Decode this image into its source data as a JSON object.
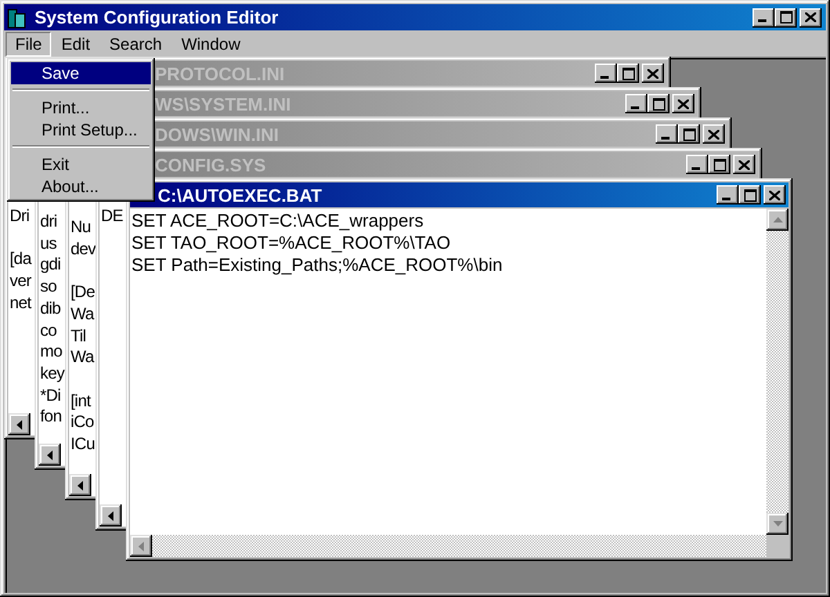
{
  "window": {
    "title": "System Configuration Editor"
  },
  "menu_bar": [
    {
      "label": "File",
      "selected": true
    },
    {
      "label": "Edit",
      "selected": false
    },
    {
      "label": "Search",
      "selected": false
    },
    {
      "label": "Window",
      "selected": false
    }
  ],
  "file_menu": {
    "items": [
      {
        "kind": "item",
        "label": "Save",
        "selected": true
      },
      {
        "kind": "separator"
      },
      {
        "kind": "item",
        "label": "Print...",
        "selected": false
      },
      {
        "kind": "item",
        "label": "Print Setup...",
        "selected": false
      },
      {
        "kind": "separator"
      },
      {
        "kind": "item",
        "label": "Exit",
        "selected": false
      },
      {
        "kind": "item",
        "label": "About...",
        "selected": false
      }
    ]
  },
  "documents": [
    {
      "title": "PROTOCOL.INI",
      "active": false,
      "lines": [
        {
          "text": "Dri",
          "blank_before": false
        },
        {
          "text": "[da",
          "blank_before": true
        },
        {
          "text": "ver",
          "blank_before": false
        },
        {
          "text": "net",
          "blank_before": false
        }
      ]
    },
    {
      "title": "WS\\SYSTEM.INI",
      "active": false,
      "lines": [
        {
          "text": "dri",
          "blank_before": false
        },
        {
          "text": "us",
          "blank_before": false
        },
        {
          "text": "gdi",
          "blank_before": false
        },
        {
          "text": "so",
          "blank_before": false
        },
        {
          "text": "dib",
          "blank_before": false
        },
        {
          "text": "co",
          "blank_before": false
        },
        {
          "text": "mo",
          "blank_before": false
        },
        {
          "text": "key",
          "blank_before": false
        },
        {
          "text": "*Di",
          "blank_before": false
        },
        {
          "text": "fon",
          "blank_before": false
        }
      ]
    },
    {
      "title": "DOWS\\WIN.INI",
      "active": false,
      "lines": [
        {
          "text": "Nu",
          "blank_before": false
        },
        {
          "text": "dev",
          "blank_before": false
        },
        {
          "text": "[De",
          "blank_before": true
        },
        {
          "text": "Wa",
          "blank_before": false
        },
        {
          "text": "Til",
          "blank_before": false
        },
        {
          "text": "Wa",
          "blank_before": false
        },
        {
          "text": "[int",
          "blank_before": true
        },
        {
          "text": "iCo",
          "blank_before": false
        },
        {
          "text": "ICu",
          "blank_before": false
        }
      ]
    },
    {
      "title": "CONFIG.SYS",
      "active": false,
      "lines": [
        {
          "text": "DE",
          "blank_before": false
        }
      ]
    },
    {
      "title": "C:\\AUTOEXEC.BAT",
      "active": true,
      "lines": [
        {
          "text": "SET ACE_ROOT=C:\\ACE_wrappers",
          "blank_before": false
        },
        {
          "text": "SET TAO_ROOT=%ACE_ROOT%\\TAO",
          "blank_before": false
        },
        {
          "text": "SET Path=Existing_Paths;%ACE_ROOT%\\bin",
          "blank_before": false
        }
      ]
    }
  ]
}
